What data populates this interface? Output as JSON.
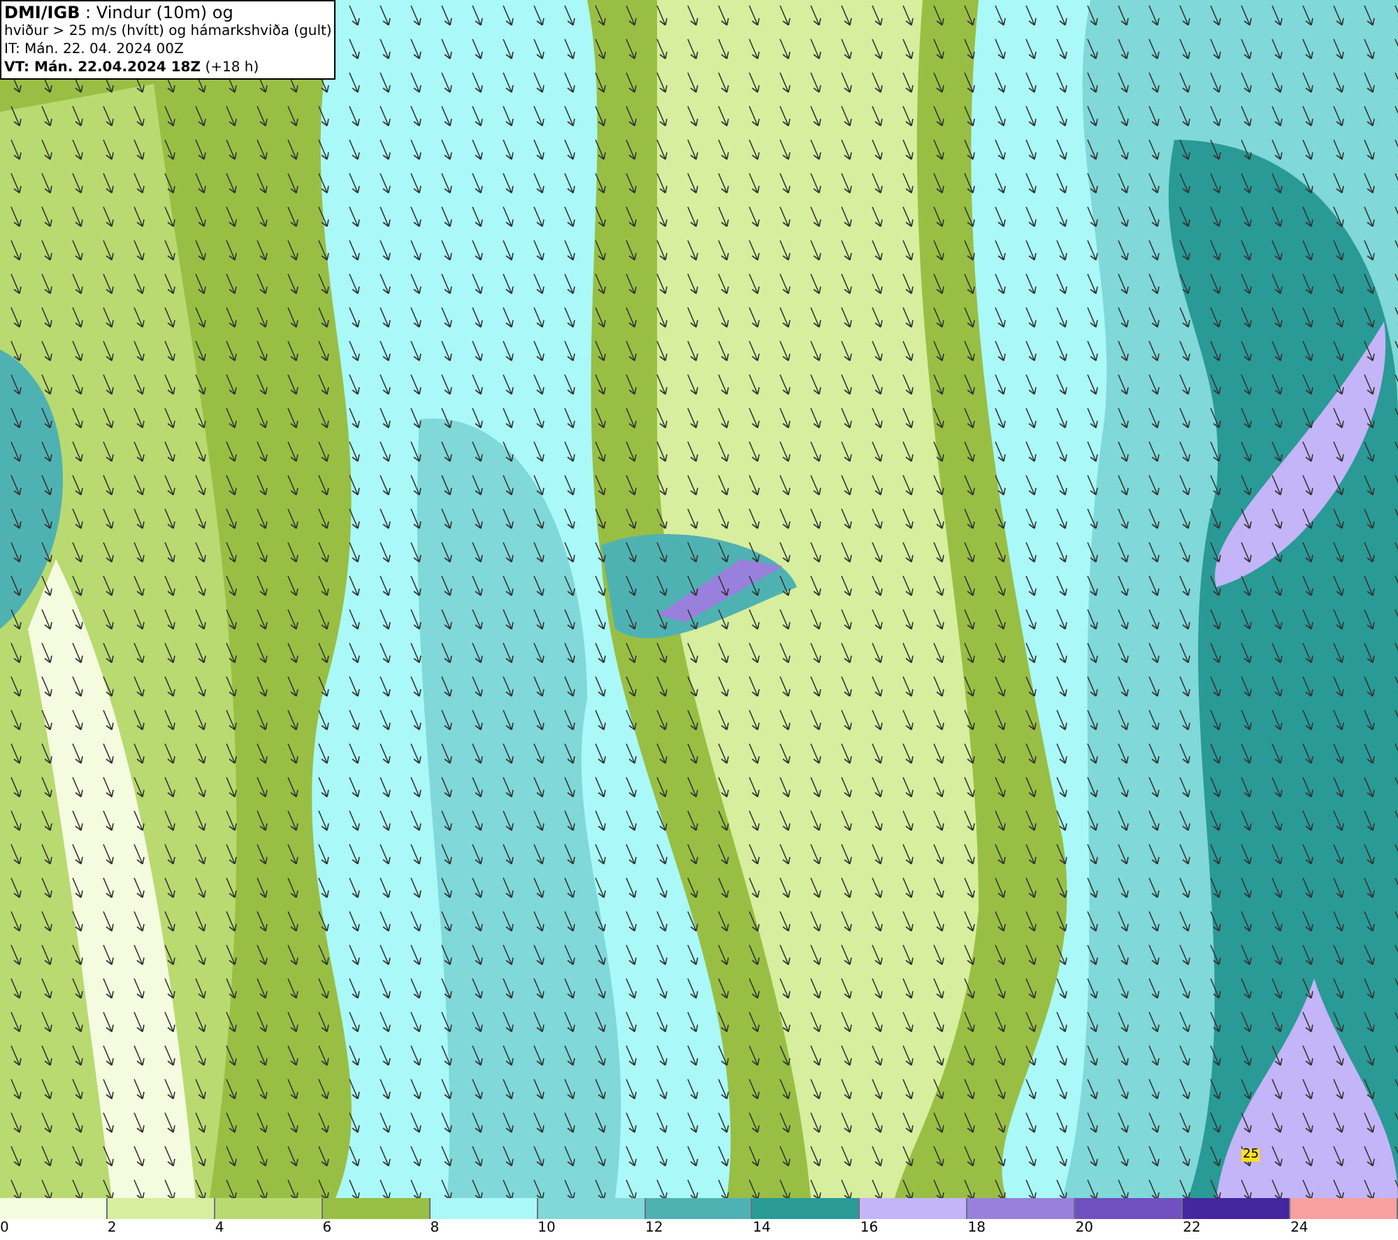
{
  "map": {
    "gust_label": "25"
  },
  "title_box": {
    "lines": [
      "**DMI/IGB** : Vindur (10m) og",
      "hviður > 25 m/s (hvítt) og hámarkshviða (gult)",
      "IT: Mán. 22. 04. 2024 00Z",
      "**VT: Mán. 22.04.2024 18Z** (+18 h)"
    ]
  },
  "legend": [
    {
      "label": "0",
      "color": "#f5fbdf"
    },
    {
      "label": "2",
      "color": "#d6ee9e"
    },
    {
      "label": "4",
      "color": "#b8da70"
    },
    {
      "label": "6",
      "color": "#98bf44"
    },
    {
      "label": "8",
      "color": "#aaf8f8"
    },
    {
      "label": "10",
      "color": "#80d8d8"
    },
    {
      "label": "12",
      "color": "#4fb2b2"
    },
    {
      "label": "14",
      "color": "#2a9a96"
    },
    {
      "label": "16",
      "color": "#c4b4f8"
    },
    {
      "label": "18",
      "color": "#9880dc"
    },
    {
      "label": "20",
      "color": "#7050c0"
    },
    {
      "label": "22",
      "color": "#4426a0"
    },
    {
      "label": "24",
      "color": "#f8a0a0"
    }
  ]
}
